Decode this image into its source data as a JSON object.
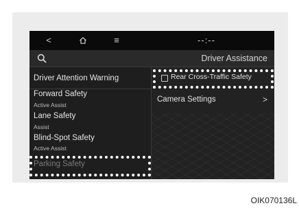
{
  "topbar": {
    "back_icon": "chevron-left-icon",
    "back_glyph": "<",
    "home_icon": "home-icon",
    "menu_icon": "menu-icon",
    "menu_glyph": "≡",
    "time": "--:--"
  },
  "subbar": {
    "search_icon": "search-icon",
    "title": "Driver Assistance"
  },
  "left_menu": {
    "items": [
      {
        "label": "Driver Attention Warning",
        "sub": ""
      },
      {
        "label": "Forward Safety",
        "sub": "Active Assist"
      },
      {
        "label": "Lane Safety",
        "sub": "Assist"
      },
      {
        "label": "Blind-Spot Safety",
        "sub": "Active Assist"
      },
      {
        "label": "Parking Safety",
        "sub": ""
      }
    ]
  },
  "right_panel": {
    "items": [
      {
        "label": "Rear Cross-Traffic Safety",
        "checkbox": true
      },
      {
        "label": "Camera Settings",
        "chevron": ">"
      }
    ]
  },
  "caption": "OIK070136L",
  "colors": {
    "frame": "#ececec",
    "screen": "#1c1c1c",
    "highlight": "#ffffff"
  }
}
